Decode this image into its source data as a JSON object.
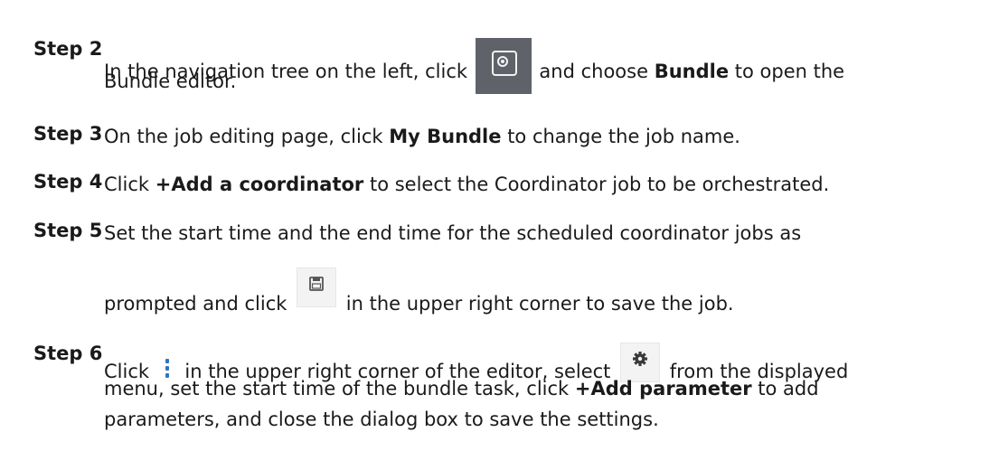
{
  "steps": [
    {
      "label": "Step 2",
      "line1_a": "In the navigation tree on the left, click",
      "icon": "target-circle-icon",
      "line1_b": "and choose",
      "line1_bold": "Bundle",
      "line1_c": "to open the",
      "line2": "Bundle editor."
    },
    {
      "label": "Step 3",
      "text_a": "On the job editing page, click",
      "text_bold": "My Bundle",
      "text_b": "to change the job name."
    },
    {
      "label": "Step 4",
      "text_a": "Click",
      "text_bold": "+Add a coordinator",
      "text_b": "to select the Coordinator job to be orchestrated."
    },
    {
      "label": "Step 5",
      "line1": "Set the start time and the end time for the scheduled coordinator jobs as",
      "line2_a": "prompted and click",
      "icon": "save-floppy-icon",
      "line2_b": "in the upper right corner to save the job."
    },
    {
      "label": "Step 6",
      "line1_a": "Click",
      "icon1": "vertical-dots-menu-icon",
      "line1_b": "in the upper right corner of the editor, select",
      "icon2": "gear-icon",
      "line1_c": "from the displayed",
      "line2_a": "menu, set the start time of the bundle task, click",
      "line2_bold": "+Add parameter",
      "line2_b": "to add",
      "line3": "parameters, and close the dialog box to save the settings."
    }
  ],
  "colors": {
    "text": "#1a1a1a",
    "nav_icon_bg": "#5f6369",
    "menu_dots": "#2f74c0",
    "button_icon_bg": "#f3f3f3"
  }
}
